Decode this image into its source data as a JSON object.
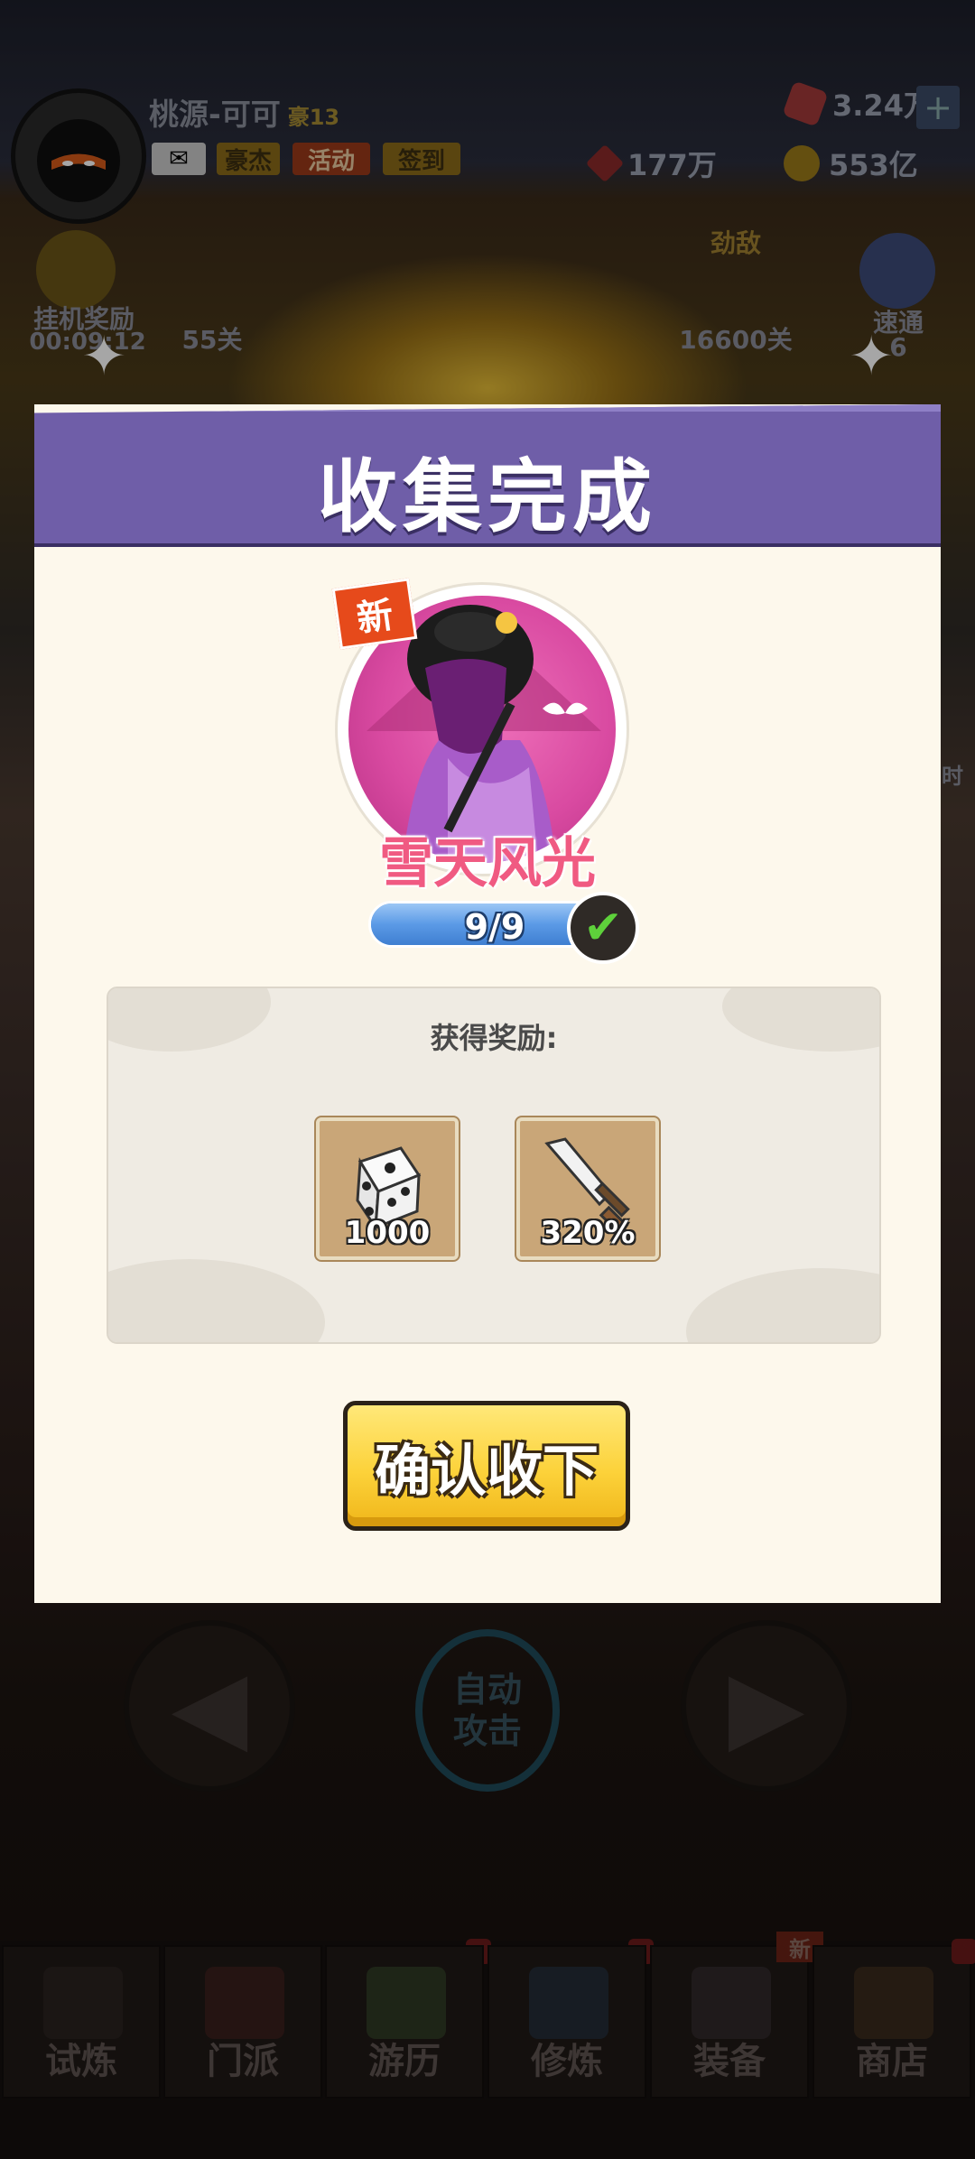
{
  "header": {
    "player_name": "桃源-可可",
    "level": "豪13",
    "chips": [
      "豪杰",
      "活动",
      "签到"
    ],
    "gems": "3.24万",
    "power": "177万",
    "gold": "553亿",
    "plus": "+"
  },
  "hud": {
    "idle_reward_label": "挂机奖励",
    "idle_timer": "00:09:12",
    "stage_current": "55关",
    "rival_label": "劲敌",
    "rival_stage": "16600关",
    "clear_label": "速通",
    "clear_value": "6"
  },
  "modal": {
    "title": "收集完成",
    "new_badge": "新",
    "skin_name": "雪天风光",
    "progress_text": "9/9",
    "progress_fraction": 1.0,
    "reward_title": "获得奖励:",
    "rewards": [
      {
        "icon": "dice-icon",
        "qty": "1000"
      },
      {
        "icon": "sword-icon",
        "qty": "320%"
      }
    ],
    "confirm_label": "确认收下"
  },
  "controls": {
    "auto_line1": "自动",
    "auto_line2": "攻击"
  },
  "nav": {
    "items": [
      "试炼",
      "门派",
      "游历",
      "修炼",
      "装备",
      "商店"
    ],
    "new_badge": "新"
  },
  "side_timer": "时"
}
